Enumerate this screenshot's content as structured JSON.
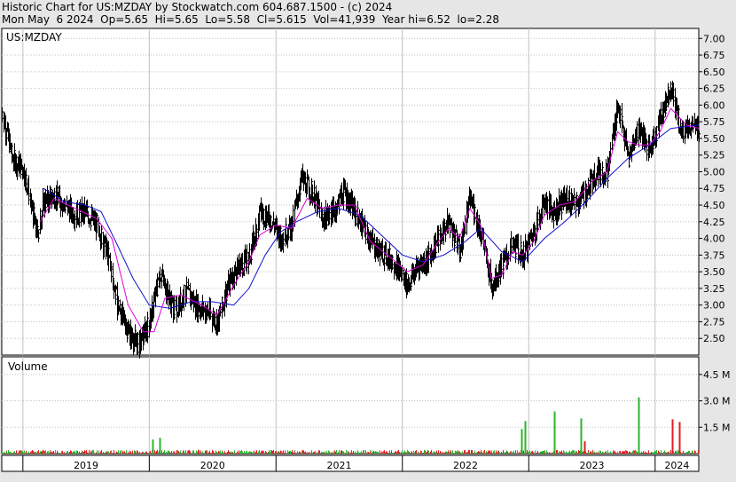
{
  "header": {
    "line1": "Historic Chart for US:MZDAY by Stockwatch.com 604.687.1500 - (c) 2024",
    "line2": "Mon May  6 2024  Op=5.65  Hi=5.65  Lo=5.58  Cl=5.615  Vol=41,939  Year hi=6.52  lo=2.28"
  },
  "chart_data": [
    {
      "type": "line",
      "title": "US:MZDAY",
      "subtype": "price-hlc-bars-with-moving-averages",
      "y_ticks": [
        "7.00",
        "6.75",
        "6.50",
        "6.25",
        "6.00",
        "5.75",
        "5.50",
        "5.25",
        "5.00",
        "4.75",
        "4.50",
        "4.25",
        "4.00",
        "3.75",
        "3.50",
        "3.25",
        "3.00",
        "2.75",
        "2.50"
      ],
      "ylim": [
        2.25,
        7.15
      ],
      "x_ticks": [
        "2019",
        "2020",
        "2021",
        "2022",
        "2023",
        "2024"
      ],
      "x_range": [
        "2018-11-01",
        "2024-05-06"
      ],
      "grid": true,
      "series": [
        {
          "style": "black-price-bars",
          "points": [
            [
              "2018-11-01",
              5.9
            ],
            [
              "2018-12-01",
              5.2
            ],
            [
              "2019-01-01",
              5.05
            ],
            [
              "2019-01-20",
              4.6
            ],
            [
              "2019-02-10",
              4.05
            ],
            [
              "2019-03-01",
              4.55
            ],
            [
              "2019-04-01",
              4.65
            ],
            [
              "2019-05-01",
              4.5
            ],
            [
              "2019-06-01",
              4.35
            ],
            [
              "2019-07-01",
              4.4
            ],
            [
              "2019-08-01",
              4.2
            ],
            [
              "2019-09-01",
              3.8
            ],
            [
              "2019-10-01",
              3.0
            ],
            [
              "2019-11-01",
              2.6
            ],
            [
              "2019-12-01",
              2.4
            ],
            [
              "2020-01-01",
              2.75
            ],
            [
              "2020-02-01",
              3.5
            ],
            [
              "2020-02-20",
              3.2
            ],
            [
              "2020-03-15",
              2.9
            ],
            [
              "2020-04-15",
              3.2
            ],
            [
              "2020-05-15",
              3.0
            ],
            [
              "2020-06-15",
              2.9
            ],
            [
              "2020-07-15",
              2.75
            ],
            [
              "2020-08-15",
              3.3
            ],
            [
              "2020-09-15",
              3.6
            ],
            [
              "2020-10-15",
              3.7
            ],
            [
              "2020-11-15",
              4.4
            ],
            [
              "2020-12-15",
              4.3
            ],
            [
              "2021-01-15",
              4.0
            ],
            [
              "2021-02-15",
              4.2
            ],
            [
              "2021-03-15",
              4.9
            ],
            [
              "2021-04-15",
              4.7
            ],
            [
              "2021-05-15",
              4.3
            ],
            [
              "2021-06-15",
              4.4
            ],
            [
              "2021-07-15",
              4.7
            ],
            [
              "2021-08-15",
              4.4
            ],
            [
              "2021-09-15",
              4.1
            ],
            [
              "2021-10-15",
              3.85
            ],
            [
              "2021-11-15",
              3.75
            ],
            [
              "2021-12-15",
              3.6
            ],
            [
              "2022-01-15",
              3.3
            ],
            [
              "2022-02-15",
              3.6
            ],
            [
              "2022-03-15",
              3.7
            ],
            [
              "2022-04-15",
              4.0
            ],
            [
              "2022-05-15",
              4.25
            ],
            [
              "2022-06-15",
              3.8
            ],
            [
              "2022-07-15",
              4.6
            ],
            [
              "2022-08-15",
              4.1
            ],
            [
              "2022-09-15",
              3.3
            ],
            [
              "2022-10-15",
              3.6
            ],
            [
              "2022-11-15",
              3.9
            ],
            [
              "2022-12-15",
              3.75
            ],
            [
              "2023-01-15",
              4.1
            ],
            [
              "2023-02-15",
              4.55
            ],
            [
              "2023-03-15",
              4.4
            ],
            [
              "2023-04-15",
              4.6
            ],
            [
              "2023-05-15",
              4.5
            ],
            [
              "2023-06-15",
              4.7
            ],
            [
              "2023-07-15",
              5.0
            ],
            [
              "2023-08-15",
              5.0
            ],
            [
              "2023-09-15",
              6.0
            ],
            [
              "2023-10-15",
              5.2
            ],
            [
              "2023-11-15",
              5.7
            ],
            [
              "2023-12-15",
              5.3
            ],
            [
              "2024-01-15",
              5.8
            ],
            [
              "2024-02-15",
              6.3
            ],
            [
              "2024-03-15",
              5.6
            ],
            [
              "2024-04-15",
              5.7
            ],
            [
              "2024-05-06",
              5.615
            ]
          ]
        },
        {
          "style": "magenta-short-ma",
          "points": [
            [
              "2019-02-20",
              4.25
            ],
            [
              "2019-04-01",
              4.6
            ],
            [
              "2019-06-01",
              4.45
            ],
            [
              "2019-08-01",
              4.3
            ],
            [
              "2019-09-15",
              4.0
            ],
            [
              "2019-11-01",
              3.0
            ],
            [
              "2019-12-15",
              2.6
            ],
            [
              "2020-01-15",
              2.6
            ],
            [
              "2020-02-15",
              3.1
            ],
            [
              "2020-04-01",
              3.15
            ],
            [
              "2020-06-01",
              3.0
            ],
            [
              "2020-07-15",
              2.85
            ],
            [
              "2020-09-01",
              3.3
            ],
            [
              "2020-10-15",
              3.65
            ],
            [
              "2020-11-15",
              4.05
            ],
            [
              "2021-01-01",
              4.2
            ],
            [
              "2021-02-15",
              4.15
            ],
            [
              "2021-04-01",
              4.6
            ],
            [
              "2021-05-15",
              4.45
            ],
            [
              "2021-07-01",
              4.5
            ],
            [
              "2021-08-15",
              4.5
            ],
            [
              "2021-10-01",
              3.95
            ],
            [
              "2021-12-01",
              3.7
            ],
            [
              "2022-01-15",
              3.5
            ],
            [
              "2022-03-01",
              3.6
            ],
            [
              "2022-04-15",
              3.95
            ],
            [
              "2022-05-15",
              4.15
            ],
            [
              "2022-06-15",
              4.0
            ],
            [
              "2022-07-15",
              4.45
            ],
            [
              "2022-08-15",
              4.2
            ],
            [
              "2022-09-15",
              3.4
            ],
            [
              "2022-10-15",
              3.45
            ],
            [
              "2022-11-15",
              3.8
            ],
            [
              "2022-12-15",
              3.75
            ],
            [
              "2023-01-15",
              3.95
            ],
            [
              "2023-02-15",
              4.35
            ],
            [
              "2023-04-01",
              4.5
            ],
            [
              "2023-05-15",
              4.55
            ],
            [
              "2023-07-01",
              4.85
            ],
            [
              "2023-08-15",
              5.0
            ],
            [
              "2023-09-15",
              5.6
            ],
            [
              "2023-10-15",
              5.45
            ],
            [
              "2023-11-15",
              5.4
            ],
            [
              "2023-12-15",
              5.4
            ],
            [
              "2024-01-15",
              5.6
            ],
            [
              "2024-02-15",
              5.95
            ],
            [
              "2024-04-01",
              5.7
            ],
            [
              "2024-05-06",
              5.65
            ]
          ]
        },
        {
          "style": "blue-long-ma",
          "points": [
            [
              "2019-03-01",
              4.75
            ],
            [
              "2019-05-01",
              4.55
            ],
            [
              "2019-07-01",
              4.5
            ],
            [
              "2019-08-15",
              4.4
            ],
            [
              "2019-10-01",
              3.9
            ],
            [
              "2019-11-15",
              3.4
            ],
            [
              "2020-01-01",
              3.0
            ],
            [
              "2020-03-01",
              2.95
            ],
            [
              "2020-05-01",
              3.05
            ],
            [
              "2020-07-01",
              3.05
            ],
            [
              "2020-09-01",
              3.0
            ],
            [
              "2020-10-15",
              3.25
            ],
            [
              "2020-12-01",
              3.75
            ],
            [
              "2021-01-15",
              4.1
            ],
            [
              "2021-03-01",
              4.25
            ],
            [
              "2021-05-01",
              4.4
            ],
            [
              "2021-07-01",
              4.45
            ],
            [
              "2021-09-01",
              4.35
            ],
            [
              "2021-11-01",
              4.05
            ],
            [
              "2022-01-01",
              3.75
            ],
            [
              "2022-03-01",
              3.65
            ],
            [
              "2022-05-01",
              3.75
            ],
            [
              "2022-07-01",
              3.95
            ],
            [
              "2022-08-15",
              4.15
            ],
            [
              "2022-10-15",
              3.8
            ],
            [
              "2022-12-15",
              3.65
            ],
            [
              "2023-02-15",
              4.0
            ],
            [
              "2023-04-15",
              4.25
            ],
            [
              "2023-06-15",
              4.55
            ],
            [
              "2023-08-15",
              4.9
            ],
            [
              "2023-10-15",
              5.2
            ],
            [
              "2023-12-15",
              5.4
            ],
            [
              "2024-02-15",
              5.65
            ],
            [
              "2024-05-06",
              5.7
            ]
          ]
        }
      ]
    },
    {
      "type": "bar",
      "title": "Volume",
      "y_ticks": [
        "4.5 M",
        "3.0 M",
        "1.5 M"
      ],
      "ylim": [
        0,
        5.5
      ],
      "unit": "million shares",
      "x_range": [
        "2018-11-01",
        "2024-05-06"
      ],
      "spikes": [
        {
          "date": "2020-01-10",
          "value": 0.8,
          "color": "green"
        },
        {
          "date": "2020-02-01",
          "value": 0.9,
          "color": "green"
        },
        {
          "date": "2022-12-12",
          "value": 1.4,
          "color": "green"
        },
        {
          "date": "2022-12-20",
          "value": 1.85,
          "color": "green"
        },
        {
          "date": "2023-03-15",
          "value": 2.4,
          "color": "green"
        },
        {
          "date": "2023-06-01",
          "value": 2.0,
          "color": "green"
        },
        {
          "date": "2023-06-10",
          "value": 0.7,
          "color": "red"
        },
        {
          "date": "2023-11-15",
          "value": 3.2,
          "color": "green"
        },
        {
          "date": "2024-02-20",
          "value": 1.95,
          "color": "red"
        },
        {
          "date": "2024-03-10",
          "value": 1.8,
          "color": "red"
        }
      ]
    }
  ],
  "colors": {
    "background": "#e6e6e6",
    "plot_bg": "#ffffff",
    "grid": "#c0c0c0",
    "price": "#000000",
    "short_ma": "#e000e0",
    "long_ma": "#1010d0",
    "vol_up": "#2db52d",
    "vol_down": "#e02020"
  }
}
